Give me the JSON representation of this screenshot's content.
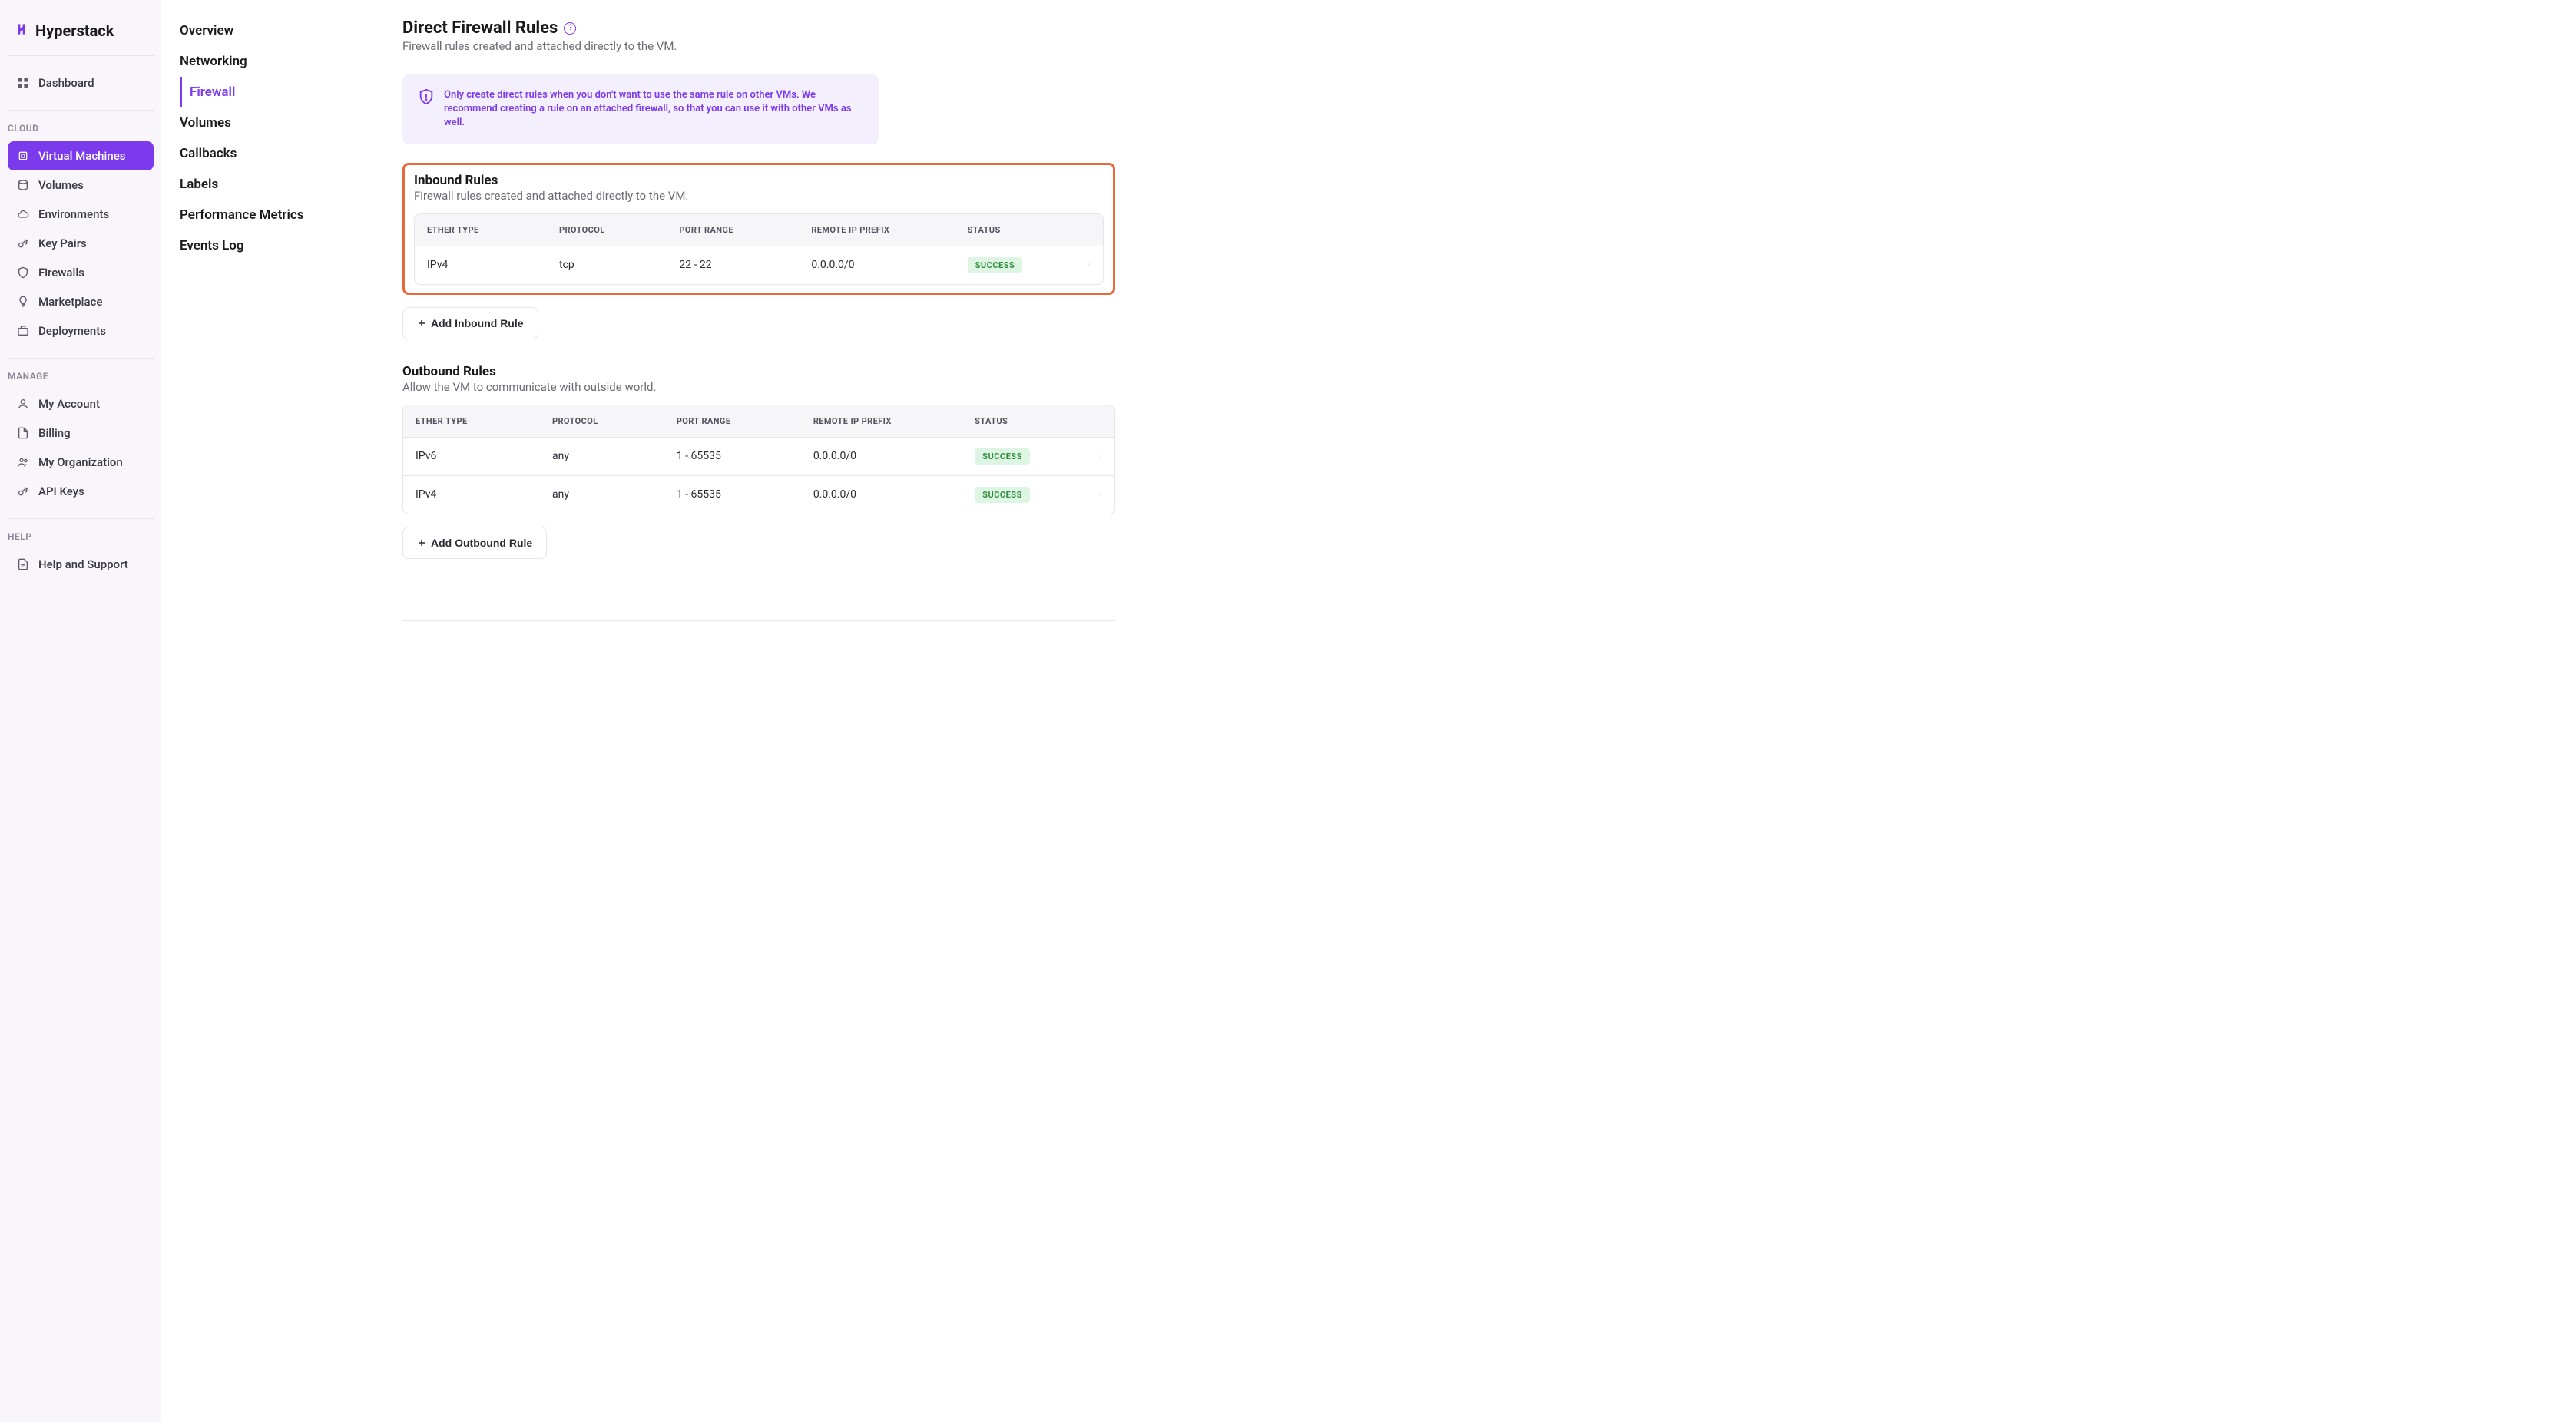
{
  "brand": {
    "name": "Hyperstack"
  },
  "sidebar": {
    "dashboard": "Dashboard",
    "groups": [
      {
        "header": "CLOUD",
        "items": [
          {
            "label": "Virtual Machines",
            "active": true,
            "icon": "cpu-icon"
          },
          {
            "label": "Volumes",
            "icon": "disk-icon"
          },
          {
            "label": "Environments",
            "icon": "cloud-icon"
          },
          {
            "label": "Key Pairs",
            "icon": "key-icon"
          },
          {
            "label": "Firewalls",
            "icon": "shield-icon"
          },
          {
            "label": "Marketplace",
            "icon": "bulb-icon"
          },
          {
            "label": "Deployments",
            "icon": "briefcase-icon"
          }
        ]
      },
      {
        "header": "MANAGE",
        "items": [
          {
            "label": "My Account",
            "icon": "user-icon"
          },
          {
            "label": "Billing",
            "icon": "file-icon"
          },
          {
            "label": "My Organization",
            "icon": "users-icon"
          },
          {
            "label": "API Keys",
            "icon": "key-icon"
          }
        ]
      },
      {
        "header": "HELP",
        "items": [
          {
            "label": "Help and Support",
            "icon": "doc-icon"
          }
        ]
      }
    ]
  },
  "subnav": {
    "items": [
      "Overview",
      "Networking",
      "Firewall",
      "Volumes",
      "Callbacks",
      "Labels",
      "Performance Metrics",
      "Events Log"
    ],
    "activeIndex": 2
  },
  "page": {
    "title": "Direct Firewall Rules",
    "subtitle": "Firewall rules created and attached directly to the VM.",
    "warning": "Only create direct rules when you don't want to use the same rule on other VMs. We recommend creating a rule on an attached firewall, so that you can use it with other VMs as well.",
    "columns": [
      "ETHER TYPE",
      "PROTOCOL",
      "PORT RANGE",
      "REMOTE IP PREFIX",
      "STATUS"
    ],
    "inbound": {
      "title": "Inbound Rules",
      "subtitle": "Firewall rules created and attached directly to the VM.",
      "rows": [
        {
          "ether": "IPv4",
          "protocol": "tcp",
          "port": "22 - 22",
          "prefix": "0.0.0.0/0",
          "status": "SUCCESS"
        }
      ],
      "addLabel": "Add Inbound Rule"
    },
    "outbound": {
      "title": "Outbound Rules",
      "subtitle": "Allow the VM to communicate with outside world.",
      "rows": [
        {
          "ether": "IPv6",
          "protocol": "any",
          "port": "1 - 65535",
          "prefix": "0.0.0.0/0",
          "status": "SUCCESS"
        },
        {
          "ether": "IPv4",
          "protocol": "any",
          "port": "1 - 65535",
          "prefix": "0.0.0.0/0",
          "status": "SUCCESS"
        }
      ],
      "addLabel": "Add Outbound Rule"
    }
  },
  "colors": {
    "accent": "#7c3aed",
    "highlight": "#e8693e",
    "success_bg": "#dff5e4",
    "success_fg": "#2f8f3f"
  }
}
